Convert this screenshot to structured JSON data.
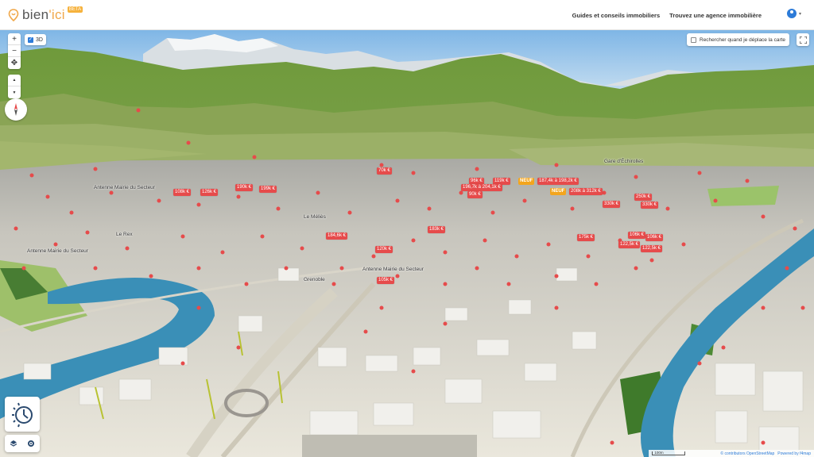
{
  "header": {
    "logo_text_a": "bien",
    "logo_text_b": "'ici",
    "beta": "BETA",
    "nav": [
      "Guides et conseils immobiliers",
      "Trouvez une agence immobilière"
    ]
  },
  "map_controls": {
    "zoom_in": "+",
    "zoom_out": "−",
    "locate": "✥",
    "tilt_up": "▲",
    "tilt_down": "▼",
    "toggle_3d_label": "3D",
    "search_on_move_label": "Rechercher quand je déplace la carte"
  },
  "places": [
    {
      "label": "Gare d'Échirolles"
    },
    {
      "label": "Antenne Mairie du Secteur"
    },
    {
      "label": "Le Rex"
    },
    {
      "label": "Le Méliès"
    },
    {
      "label": "Antenne Mairie du Secteur"
    },
    {
      "label": "Antenne Mairie du Secteur"
    },
    {
      "label": "Grenoble"
    }
  ],
  "prices": [
    "70k €",
    "108k €",
    "126k €",
    "190k €",
    "199k €",
    "96k €",
    "119k €",
    "196,7k à 204,1k €",
    "187,4k à 198,2k €",
    "208k à 312k €",
    "90k €",
    "330k €",
    "330k €",
    "250k €",
    "184,6k €",
    "183k €",
    "175k €",
    "106k €",
    "106k €",
    "122,5k €",
    "122,5k €",
    "120k €",
    "105k €"
  ],
  "neuf_label": "NEUF",
  "attribution": {
    "scale": "100m",
    "osm": "© contributors OpenStreetMap",
    "powered": "Powered by f4map"
  },
  "colors": {
    "accent": "#2d7bd8",
    "listing": "#e64b4b",
    "neuf": "#f3a51d",
    "river": "#3a8fb7"
  }
}
